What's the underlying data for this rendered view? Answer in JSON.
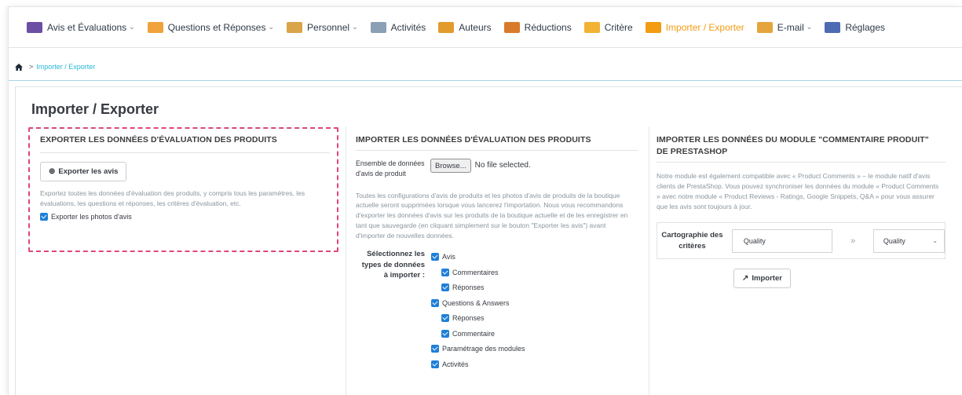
{
  "nav": {
    "items": [
      {
        "label": "Avis et Évaluations",
        "icon": "keyboard-icon",
        "color": "#6b4fa3",
        "dropdown": true
      },
      {
        "label": "Questions et Réponses",
        "icon": "qa-icon",
        "color": "#f0a23c",
        "dropdown": true
      },
      {
        "label": "Personnel",
        "icon": "staff-icon",
        "color": "#d9a44a",
        "dropdown": true
      },
      {
        "label": "Activités",
        "icon": "activity-icon",
        "color": "#8aa0b4",
        "dropdown": false
      },
      {
        "label": "Auteurs",
        "icon": "authors-icon",
        "color": "#e29b2d",
        "dropdown": false
      },
      {
        "label": "Réductions",
        "icon": "discount-icon",
        "color": "#d97a2a",
        "dropdown": false
      },
      {
        "label": "Critère",
        "icon": "criteria-icon",
        "color": "#f2b233",
        "dropdown": false
      },
      {
        "label": "Importer / Exporter",
        "icon": "import-export-icon",
        "color": "#f39c12",
        "dropdown": false,
        "active": true
      },
      {
        "label": "E-mail",
        "icon": "email-icon",
        "color": "#e6a43d",
        "dropdown": true
      },
      {
        "label": "Réglages",
        "icon": "settings-icon",
        "color": "#4d6bb3",
        "dropdown": false
      }
    ]
  },
  "breadcrumb": {
    "separator": ">",
    "current": "Importer / Exporter"
  },
  "page": {
    "title": "Importer / Exporter"
  },
  "export": {
    "title": "EXPORTER LES DONNÉES D'ÉVALUATION DES PRODUITS",
    "button": "Exporter les avis",
    "description": "Exportez toutes les données d'évaluation des produits, y compris tous les paramètres, les évaluations, les questions et réponses, les critères d'évaluation, etc.",
    "photos_label": "Exporter les photos d'avis"
  },
  "import": {
    "title": "IMPORTER LES DONNÉES D'ÉVALUATION DES PRODUITS",
    "file_label": "Ensemble de données d'avis de produit",
    "browse": "Browse...",
    "no_file": "No file selected.",
    "warning": "Toutes les configurations d'avis de produits et les photos d'avis de produits de la boutique actuelle seront supprimées lorsque vous lancerez l'importation. Nous vous recommandons d'exporter les données d'avis sur les produits de la boutique actuelle et de les enregistrer en tant que sauvegarde (en cliquant simplement sur le bouton \"Exporter les avis\") avant d'importer de nouvelles données.",
    "types_label": "Sélectionnez les types de données à importer :",
    "types": [
      {
        "label": "Avis",
        "indent": 0
      },
      {
        "label": "Commentaires",
        "indent": 1
      },
      {
        "label": "Réponses",
        "indent": 1
      },
      {
        "label": "Questions & Answers",
        "indent": 0
      },
      {
        "label": "Réponses",
        "indent": 1
      },
      {
        "label": "Commentaire",
        "indent": 1
      },
      {
        "label": "Paramétrage des modules",
        "indent": 0
      },
      {
        "label": "Activités",
        "indent": 0
      }
    ]
  },
  "prestashop": {
    "title": "IMPORTER LES DONNÉES DU MODULE \"COMMENTAIRE PRODUIT\" DE PRESTASHOP",
    "description": "Notre module est également compatible avec « Product Comments » – le module natif d'avis clients de PrestaShop. Vous pouvez synchroniser les données du module « Product Comments » avec notre module « Product Reviews - Ratings, Google Snippets, Q&A » pour vous assurer que les avis sont toujours à jour.",
    "mapping_label": "Cartographie des critères",
    "source": "Quality",
    "arrow": "»",
    "target": "Quality",
    "button": "Importer"
  }
}
